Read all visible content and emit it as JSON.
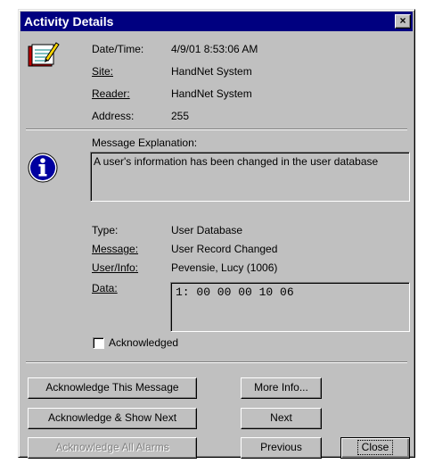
{
  "window": {
    "title": "Activity Details",
    "close_glyph": "×"
  },
  "header": {
    "datetime_label": "Date/Time:",
    "datetime_value": "4/9/01 8:53:06 AM",
    "site_label": "Site:",
    "site_value": "HandNet System",
    "reader_label": "Reader:",
    "reader_value": "HandNet System",
    "address_label": "Address:",
    "address_value": "255"
  },
  "message": {
    "explanation_label": "Message Explanation:",
    "explanation_text": "A user's information has been changed in the user database",
    "type_label": "Type:",
    "type_value": "User Database",
    "message_label": "Message:",
    "message_value": "User Record Changed",
    "userinfo_label": "User/Info:",
    "userinfo_value": "Pevensie, Lucy (1006)",
    "data_label": "Data:",
    "data_value": "1: 00 00 00 10 06",
    "acknowledged_label": "Acknowledged",
    "acknowledged_checked": false
  },
  "buttons": {
    "ack_this": "Acknowledge This Message",
    "ack_next": "Acknowledge & Show Next",
    "ack_all": "Acknowledge All Alarms",
    "more_info": "More Info...",
    "next": "Next",
    "previous": "Previous",
    "close": "Close"
  },
  "icons": {
    "log_icon": "notebook-pencil-icon",
    "info_icon": "info-icon"
  }
}
